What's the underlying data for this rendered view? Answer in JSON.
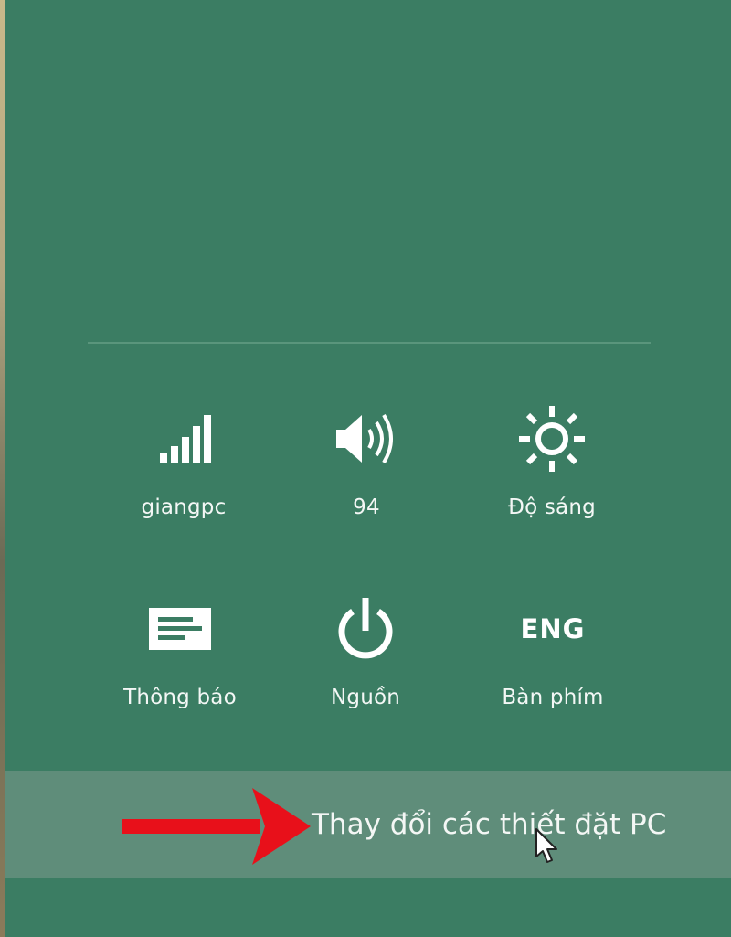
{
  "quick_settings": {
    "network": {
      "label": "giangpc",
      "icon": "wifi-signal-icon"
    },
    "volume": {
      "label": "94",
      "icon": "speaker-icon"
    },
    "brightness": {
      "label": "Độ sáng",
      "icon": "sun-icon"
    },
    "notifications": {
      "label": "Thông báo",
      "icon": "notification-icon"
    },
    "power": {
      "label": "Nguồn",
      "icon": "power-icon"
    },
    "keyboard": {
      "label": "Bàn phím",
      "icon_text": "ENG"
    }
  },
  "settings_link": {
    "label": "Thay đổi các thiết đặt PC"
  },
  "colors": {
    "background": "#3b7d63",
    "settings_bar": "#5f8d7a",
    "arrow": "#e8101a"
  }
}
